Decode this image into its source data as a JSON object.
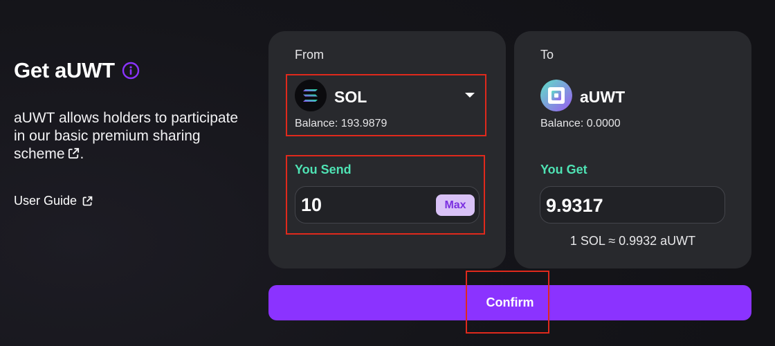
{
  "header": {
    "title": "Get aUWT",
    "info_icon": "info-icon",
    "accent_color": "#8b33ff"
  },
  "description": {
    "text": "aUWT allows holders to participate in our basic premium sharing scheme",
    "suffix": ".",
    "link_icon": "external-link-icon"
  },
  "user_guide": {
    "label": "User Guide",
    "icon": "external-link-icon"
  },
  "from_card": {
    "label": "From",
    "token": "SOL",
    "token_icon": "solana-logo-icon",
    "balance": "Balance: 193.9879",
    "send_label": "You Send",
    "amount": "10",
    "max_label": "Max"
  },
  "to_card": {
    "label": "To",
    "token": "aUWT",
    "token_icon": "auwt-logo-icon",
    "balance": "Balance: 0.0000",
    "get_label": "You Get",
    "amount": "9.9317",
    "rate": "1 SOL ≈ 0.9932 aUWT"
  },
  "confirm": {
    "label": "Confirm"
  },
  "colors": {
    "background": "#15151a",
    "card": "#28292d",
    "green_label": "#4fe3b4",
    "highlight": "#e0291c",
    "max_bg": "#d9c2f7",
    "max_text": "#7a2fe0"
  }
}
